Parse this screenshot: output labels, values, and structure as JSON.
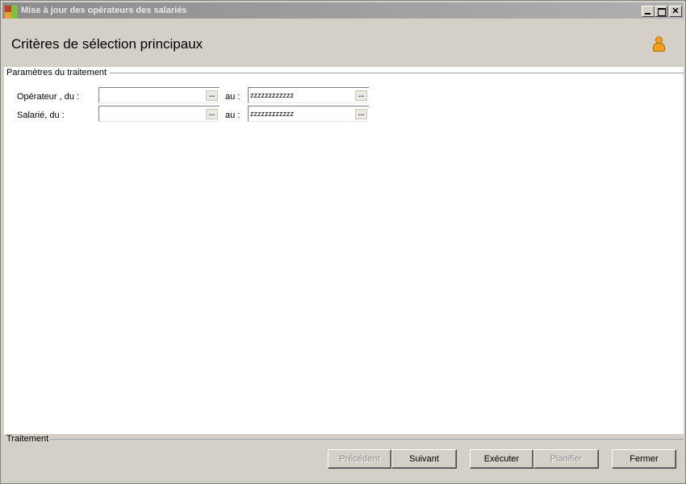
{
  "window": {
    "title": "Mise à jour des opérateurs des salariés",
    "controls": {
      "minimize": "_",
      "maximize": "□",
      "close": "✕"
    }
  },
  "header": {
    "page_title": "Critères de sélection principaux",
    "user_icon": "user-icon"
  },
  "params": {
    "group_label": "Paramètres du traitement",
    "operateur": {
      "label": "Opérateur , du :",
      "from_value": "",
      "to_label": "au :",
      "to_value": "zzzzzzzzzzzz"
    },
    "salarie": {
      "label": "Salarié, du :",
      "from_value": "",
      "to_label": "au :",
      "to_value": "zzzzzzzzzzzz"
    },
    "lookup_button_label": "..."
  },
  "footer": {
    "group_label": "Traitement",
    "buttons": {
      "previous": "Précédent",
      "next": "Suivant",
      "execute": "Exécuter",
      "schedule": "Planifier",
      "close": "Fermer"
    }
  }
}
